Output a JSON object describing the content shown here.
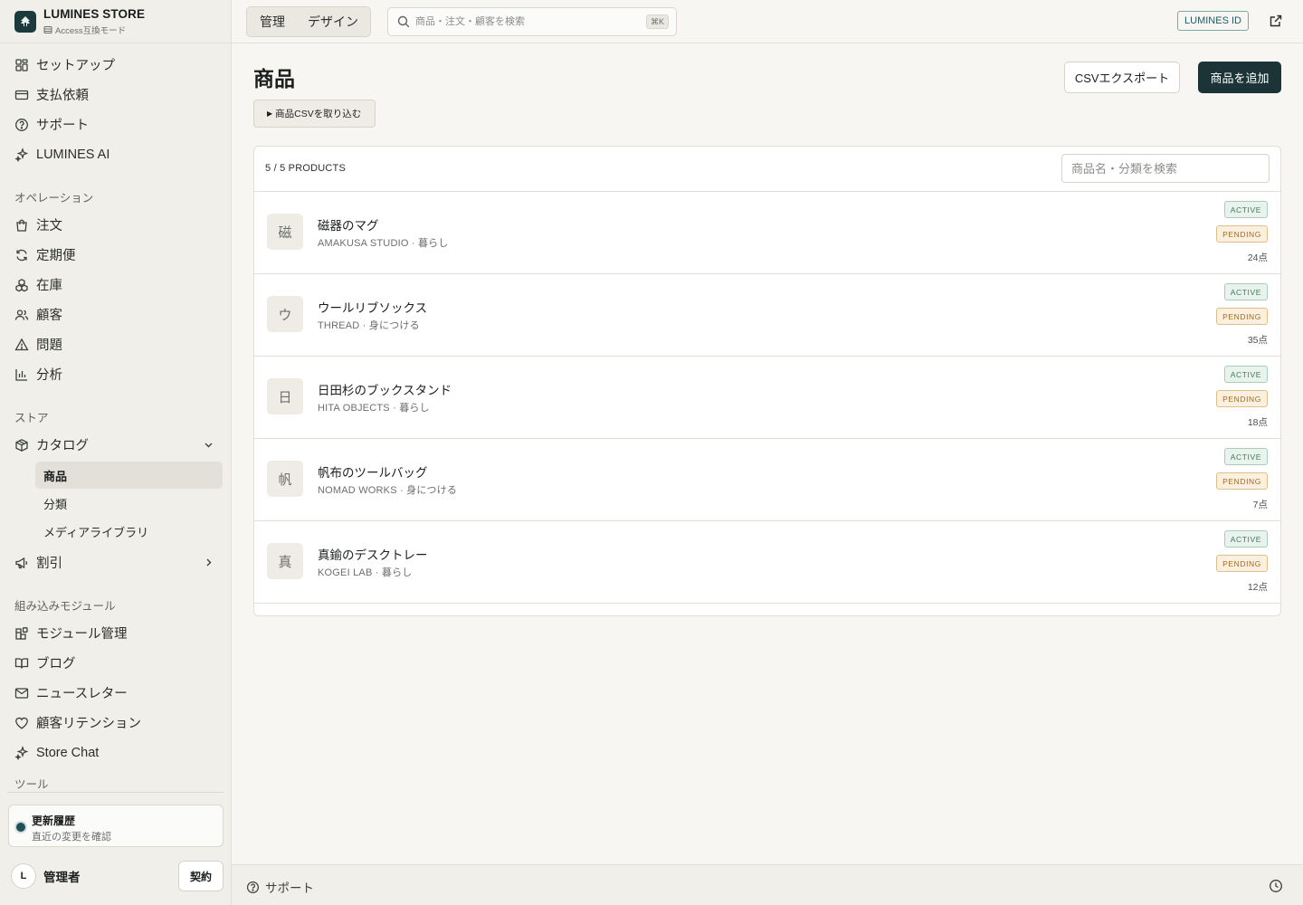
{
  "brand": {
    "name": "LUMINES STORE",
    "mode": "Access互換モード"
  },
  "sidebar": {
    "top_items": [
      {
        "label": "セットアップ",
        "icon": "dashboard-icon"
      },
      {
        "label": "支払依頼",
        "icon": "credit-card-icon"
      },
      {
        "label": "サポート",
        "icon": "help-circle-icon"
      },
      {
        "label": "LUMINES AI",
        "icon": "sparkles-icon"
      }
    ],
    "sections": {
      "operations": "オペレーション",
      "store": "ストア",
      "modules": "組み込みモジュール",
      "tools_partial": "ツール"
    },
    "operations_items": [
      {
        "label": "注文",
        "icon": "shopping-bag-icon"
      },
      {
        "label": "定期便",
        "icon": "refresh-icon"
      },
      {
        "label": "在庫",
        "icon": "boxes-icon"
      },
      {
        "label": "顧客",
        "icon": "users-icon"
      },
      {
        "label": "問題",
        "icon": "alert-triangle-icon"
      },
      {
        "label": "分析",
        "icon": "bar-chart-icon"
      }
    ],
    "catalog": {
      "label": "カタログ",
      "sub_items": [
        "商品",
        "分類",
        "メディアライブラリ"
      ]
    },
    "discount": {
      "label": "割引"
    },
    "module_items": [
      {
        "label": "モジュール管理",
        "icon": "blocks-icon"
      },
      {
        "label": "ブログ",
        "icon": "book-icon"
      },
      {
        "label": "ニュースレター",
        "icon": "mail-icon"
      },
      {
        "label": "顧客リテンション",
        "icon": "heart-icon"
      },
      {
        "label": "Store Chat",
        "icon": "sparkles-icon"
      }
    ],
    "update_card": {
      "title": "更新履歴",
      "subtitle": "直近の変更を確認"
    },
    "user": {
      "initial": "L",
      "name": "管理者",
      "contract_label": "契約"
    }
  },
  "topbar": {
    "mode_manage": "管理",
    "mode_design": "デザイン",
    "search_placeholder": "商品・注文・顧客を検索",
    "search_shortcut": "⌘K",
    "lumines_id": "LUMINES ID"
  },
  "main": {
    "title": "商品",
    "csv_export": "CSVエクスポート",
    "add_product": "商品を追加",
    "csv_import": "商品CSVを取り込む",
    "count_label": "5 / 5 PRODUCTS",
    "filter_placeholder": "商品名・分類を検索",
    "products": [
      {
        "initial": "磁",
        "name": "磁器のマグ",
        "meta": "AMAKUSA STUDIO · 暮らし",
        "status": "ACTIVE",
        "review": "PENDING",
        "stock": "24点"
      },
      {
        "initial": "ウ",
        "name": "ウールリブソックス",
        "meta": "THREAD · 身につける",
        "status": "ACTIVE",
        "review": "PENDING",
        "stock": "35点"
      },
      {
        "initial": "日",
        "name": "日田杉のブックスタンド",
        "meta": "HITA OBJECTS · 暮らし",
        "status": "ACTIVE",
        "review": "PENDING",
        "stock": "18点"
      },
      {
        "initial": "帆",
        "name": "帆布のツールバッグ",
        "meta": "NOMAD WORKS · 身につける",
        "status": "ACTIVE",
        "review": "PENDING",
        "stock": "7点"
      },
      {
        "initial": "真",
        "name": "真鍮のデスクトレー",
        "meta": "KOGEI LAB · 暮らし",
        "status": "ACTIVE",
        "review": "PENDING",
        "stock": "12点"
      }
    ]
  },
  "footer": {
    "support": "サポート"
  },
  "colors": {
    "accent": "#1c3438",
    "active": "#3f7a5a",
    "pending": "#a06a23",
    "sidebar_bg": "#f1efea"
  }
}
